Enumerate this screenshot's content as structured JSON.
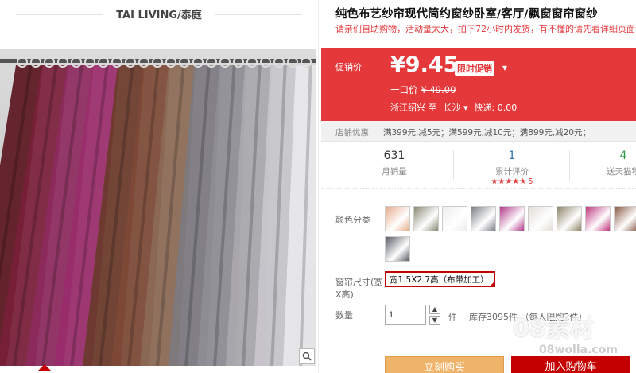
{
  "left_panel": {
    "brand": "TAI LIVING/泰庭",
    "curtain_colors": [
      "#5a1620",
      "#7a1f3a",
      "#8d2a5e",
      "#9a2d6b",
      "#6a3a2a",
      "#7e4a36",
      "#8c6a55",
      "#7c7a80",
      "#8f8d95",
      "#a9a8ad",
      "#c8c7cc",
      "#e8e7ea"
    ]
  },
  "product": {
    "title": "纯色布艺纱帘现代简约窗纱卧室/客厅/飘窗窗帘窗纱",
    "subtitle": "请亲们自助购物，活动量太大，拍下72小时内发货，有不懂的请先看详细页面说"
  },
  "promo": {
    "label": "促销价",
    "price": "¥9.45",
    "badge": "限时促销",
    "orig_label": "一口价",
    "orig_price": "¥ 49.00",
    "ship_from": "浙江绍兴 至",
    "ship_to": "长沙",
    "ship_fee": "快递: 0.00"
  },
  "coupons": {
    "label": "店铺优惠",
    "text": "满399元,减5元；满599元,减10元；满899元,减20元；"
  },
  "stats": {
    "monthly_sales": "631",
    "monthly_sales_label": "月销量",
    "reviews": "1",
    "reviews_label": "累计评价",
    "rating_stars": "★★★★★",
    "rating_count": "5",
    "points": "4",
    "points_label": "送天猫积"
  },
  "options": {
    "color_label": "颜色分类",
    "swatches": [
      "#e6ab8a",
      "#8a8a76",
      "#ededed",
      "#7b8088",
      "#b13b8b",
      "#e2ddd6",
      "#8d8467",
      "#c0377d",
      "#8a5a45",
      "#575b63"
    ],
    "size_label": "窗帘尺寸(宽",
    "size_label2": "X高)",
    "size_value": "宽1.5X2.7高（布带加工）",
    "qty_label": "数量",
    "qty_value": "1",
    "qty_unit": "件",
    "stock": "库存3095件  （每人限购2件）"
  },
  "actions": {
    "buy": "立刻购买",
    "cart": "加入购物车"
  },
  "watermark": {
    "text": "08素材",
    "sub": "08wolla.com"
  }
}
